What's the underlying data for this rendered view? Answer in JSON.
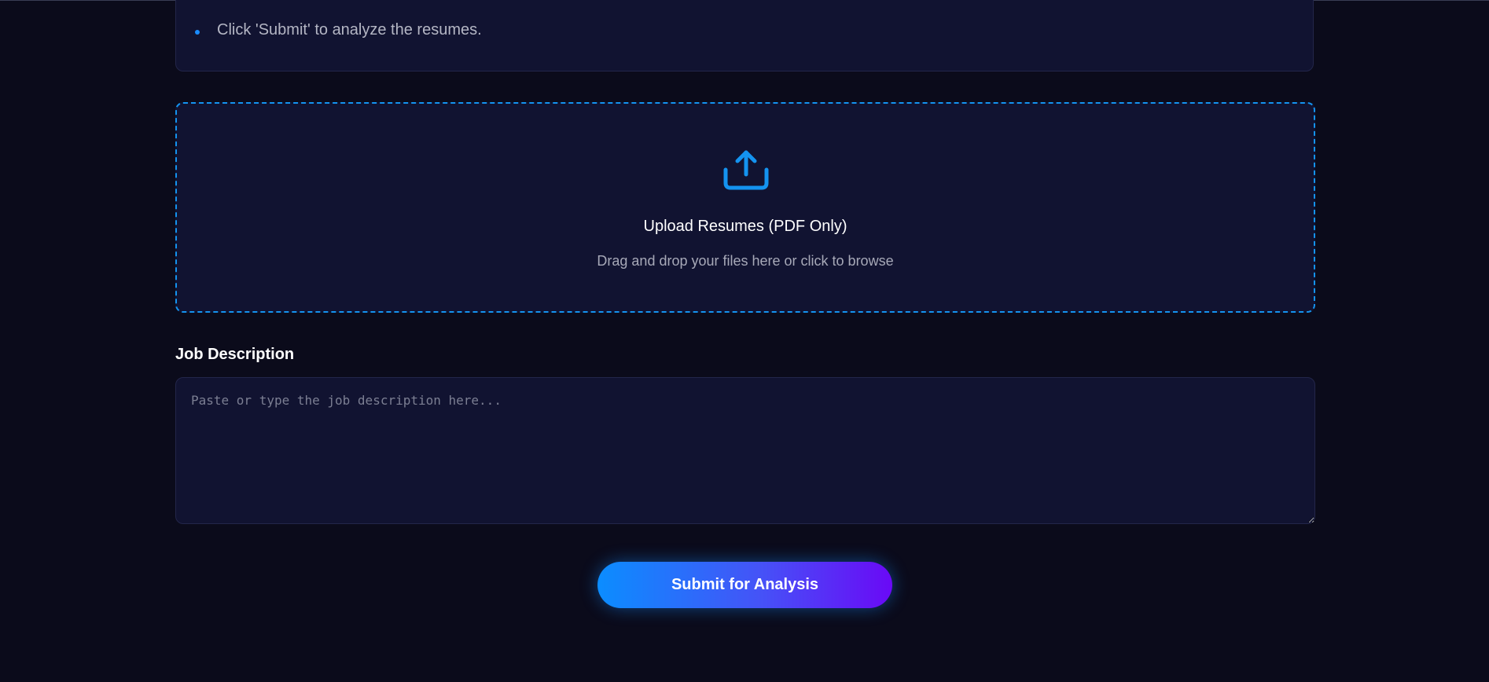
{
  "instructions": {
    "items": [
      {
        "text": "Click 'Submit' to analyze the resumes."
      }
    ]
  },
  "upload": {
    "icon": "upload-icon",
    "title": "Upload Resumes (PDF Only)",
    "subtitle": "Drag and drop your files here or click to browse"
  },
  "job_description": {
    "label": "Job Description",
    "placeholder": "Paste or type the job description here...",
    "value": ""
  },
  "submit": {
    "label": "Submit for Analysis"
  },
  "colors": {
    "background": "#0b0b1b",
    "card": "#111331",
    "accent": "#1493f0",
    "gradient_start": "#0b8dff",
    "gradient_end": "#6a09f6"
  }
}
